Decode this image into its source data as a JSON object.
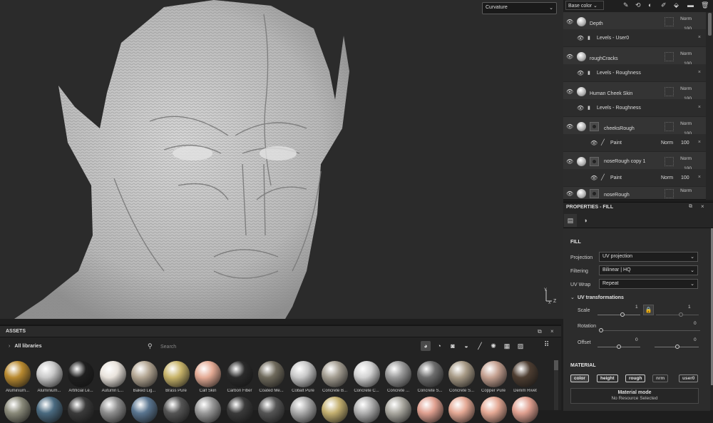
{
  "viewport": {
    "channel_select": "Curvature"
  },
  "layers": {
    "channel": "Base color",
    "items": [
      {
        "name": "Depth",
        "blend": "Norm",
        "opacity": "100",
        "effect": "Levels - User0",
        "mask": false
      },
      {
        "name": "roughCracks",
        "blend": "Norm",
        "opacity": "100",
        "effect": "Levels - Roughness",
        "mask": false
      },
      {
        "name": "Human Cheek Skin",
        "blend": "Norm",
        "opacity": "100",
        "effect": "Levels - Roughness",
        "mask": false
      },
      {
        "name": "cheeksRough",
        "blend": "Norm",
        "opacity": "100",
        "effect": "Paint",
        "effect_blend": "Norm",
        "effect_opacity": "100",
        "mask": true
      },
      {
        "name": "noseRough copy 1",
        "blend": "Norm",
        "opacity": "100",
        "effect": "Paint",
        "effect_blend": "Norm",
        "effect_opacity": "100",
        "mask": true
      },
      {
        "name": "noseRough",
        "blend": "Norm",
        "mask": true
      }
    ]
  },
  "properties": {
    "title": "PROPERTIES - FILL",
    "fill_title": "FILL",
    "projection_label": "Projection",
    "projection_value": "UV projection",
    "filtering_label": "Filtering",
    "filtering_value": "Bilinear | HQ",
    "uvwrap_label": "UV Wrap",
    "uvwrap_value": "Repeat",
    "uvt_title": "UV transformations",
    "scale_label": "Scale",
    "scale_value": "1",
    "scale_value2": "1",
    "rotation_label": "Rotation",
    "rotation_value": "0",
    "offset_label": "Offset",
    "offset_x": "0",
    "offset_y": "0",
    "material_title": "MATERIAL",
    "channels": [
      "color",
      "height",
      "rough",
      "nrm",
      "user0"
    ],
    "material_mode_title": "Material mode",
    "material_mode_sub": "No Resource Selected"
  },
  "assets": {
    "title": "ASSETS",
    "library": "All libraries",
    "search_placeholder": "Search",
    "materials": [
      {
        "name": "Aluminium...",
        "color": "#b98a30"
      },
      {
        "name": "Aluminium...",
        "color": "#c9c9c9"
      },
      {
        "name": "Artificial Le...",
        "color": "#1f1f1f"
      },
      {
        "name": "Autumn L...",
        "color": "#e9e3dc"
      },
      {
        "name": "Baked Lig...",
        "color": "#b4a794"
      },
      {
        "name": "Brass Pure",
        "color": "#c8b46a"
      },
      {
        "name": "Calf Skin",
        "color": "#e4ab95"
      },
      {
        "name": "Carbon Fiber",
        "color": "#2a2a2a"
      },
      {
        "name": "Coated Me...",
        "color": "#6f6a5c"
      },
      {
        "name": "Cobalt Pure",
        "color": "#c8c8c8"
      },
      {
        "name": "Concrete B...",
        "color": "#a49e92"
      },
      {
        "name": "Concrete C...",
        "color": "#d2d2d2"
      },
      {
        "name": "Concrete ...",
        "color": "#9a9a9a"
      },
      {
        "name": "Concrete S...",
        "color": "#6d6d6d"
      },
      {
        "name": "Concrete S...",
        "color": "#a79a86"
      },
      {
        "name": "Copper Pure",
        "color": "#c4a090"
      },
      {
        "name": "Denim Rivet",
        "color": "#4e3e32"
      }
    ],
    "row2_colors": [
      "#8a8a7a",
      "#4a6a80",
      "#3a3a3a",
      "#8e8e8e",
      "#5a7590",
      "#555",
      "#999",
      "#3a3a3a",
      "#555",
      "#aaa",
      "#c4b070",
      "#b0b0b0",
      "#aaa8a0",
      "#e0a090",
      "#e4a894",
      "#e4a894",
      "#e0a090"
    ]
  }
}
